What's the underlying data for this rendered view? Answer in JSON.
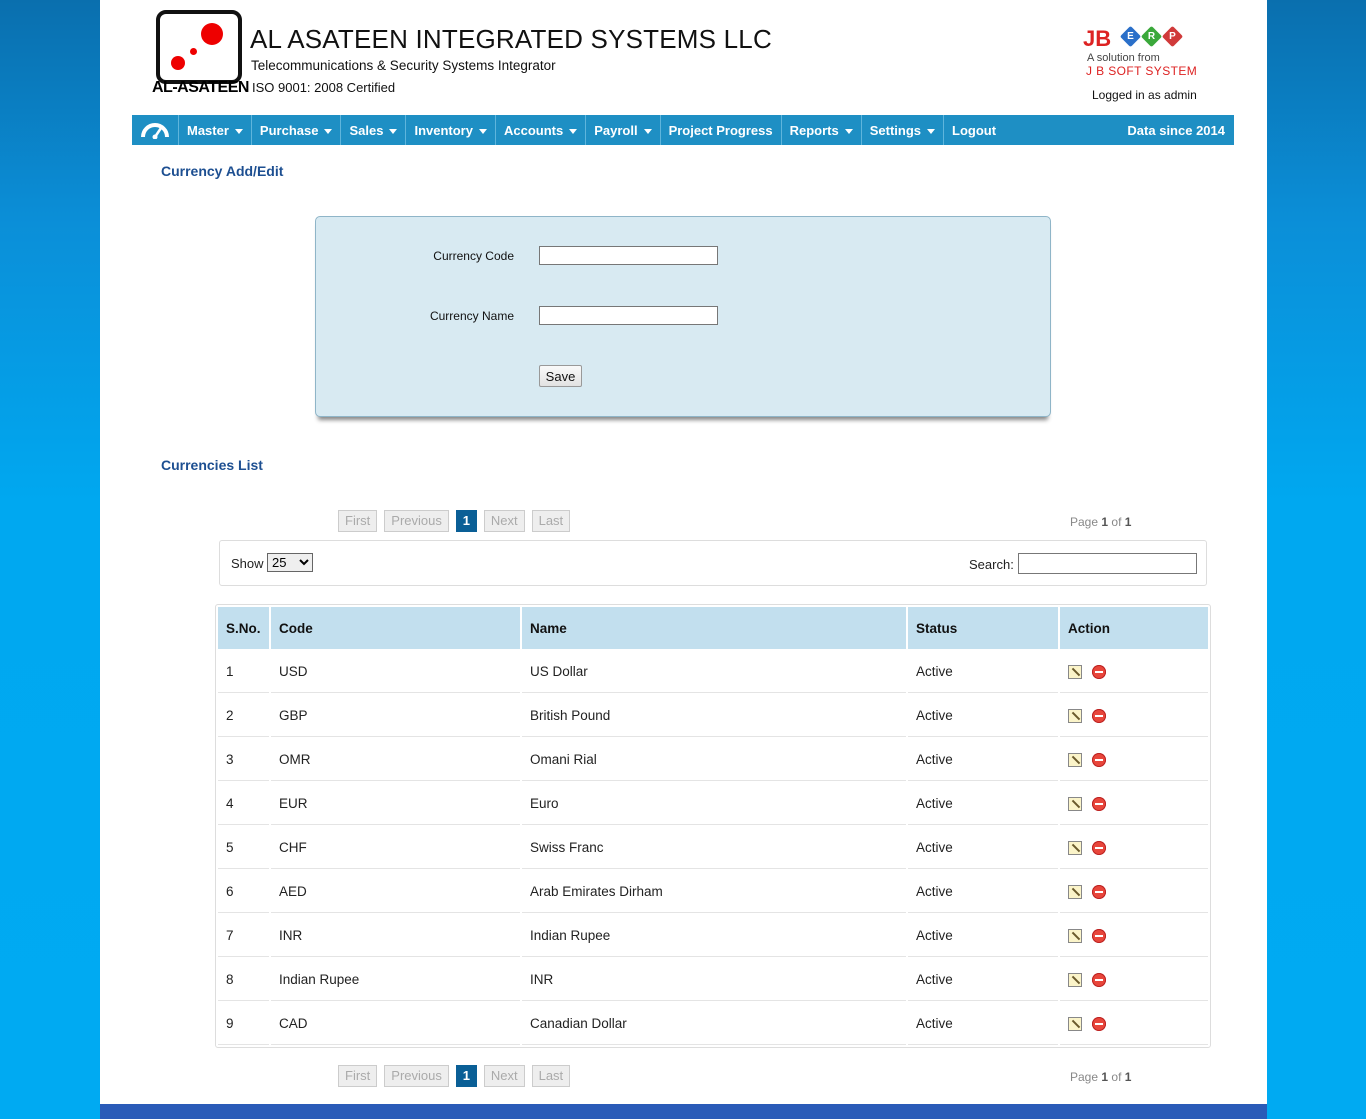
{
  "header": {
    "logo_text": "AL-ASATEEN",
    "company_name": "AL ASATEEN INTEGRATED SYSTEMS LLC",
    "company_subtitle": "Telecommunications & Security Systems Integrator",
    "iso": "ISO 9001: 2008 Certified",
    "jb_text": "JB",
    "erp_letters": [
      "E",
      "R",
      "P"
    ],
    "jb_sub1": "A solution from",
    "jb_sub2": "J B SOFT SYSTEM",
    "logged_in": "Logged in as admin"
  },
  "nav": {
    "items": [
      {
        "label": "Master",
        "dropdown": true
      },
      {
        "label": "Purchase",
        "dropdown": true
      },
      {
        "label": "Sales",
        "dropdown": true
      },
      {
        "label": "Inventory",
        "dropdown": true
      },
      {
        "label": "Accounts",
        "dropdown": true
      },
      {
        "label": "Payroll",
        "dropdown": true
      },
      {
        "label": "Project Progress",
        "dropdown": false
      },
      {
        "label": "Reports",
        "dropdown": true
      },
      {
        "label": "Settings",
        "dropdown": true
      },
      {
        "label": "Logout",
        "dropdown": false
      }
    ],
    "right_text": "Data since 2014"
  },
  "form": {
    "title": "Currency Add/Edit",
    "code_label": "Currency Code",
    "code_value": "",
    "name_label": "Currency Name",
    "name_value": "",
    "save_label": "Save"
  },
  "list": {
    "title": "Currencies List",
    "pager": {
      "first": "First",
      "previous": "Previous",
      "current": "1",
      "next": "Next",
      "last": "Last"
    },
    "page_info": {
      "prefix": "Page",
      "current": "1",
      "of": "of",
      "total": "1"
    },
    "show_label": "Show",
    "show_value": "25",
    "search_label": "Search:",
    "search_value": "",
    "columns": [
      "S.No.",
      "Code",
      "Name",
      "Status",
      "Action"
    ],
    "rows": [
      {
        "sno": "1",
        "code": "USD",
        "name": "US Dollar",
        "status": "Active"
      },
      {
        "sno": "2",
        "code": "GBP",
        "name": "British Pound",
        "status": "Active"
      },
      {
        "sno": "3",
        "code": "OMR",
        "name": "Omani Rial",
        "status": "Active"
      },
      {
        "sno": "4",
        "code": "EUR",
        "name": "Euro",
        "status": "Active"
      },
      {
        "sno": "5",
        "code": "CHF",
        "name": "Swiss Franc",
        "status": "Active"
      },
      {
        "sno": "6",
        "code": "AED",
        "name": "Arab Emirates Dirham",
        "status": "Active"
      },
      {
        "sno": "7",
        "code": "INR",
        "name": "Indian Rupee",
        "status": "Active"
      },
      {
        "sno": "8",
        "code": "Indian Rupee",
        "name": "INR",
        "status": "Active"
      },
      {
        "sno": "9",
        "code": "CAD",
        "name": "Canadian Dollar",
        "status": "Active"
      }
    ]
  },
  "colors": {
    "nav_bg": "#1e8fc4",
    "title_blue": "#1d4f91",
    "form_bg": "#d8eaf2",
    "header_row": "#c2dfee",
    "brand_red": "#dd2222"
  }
}
